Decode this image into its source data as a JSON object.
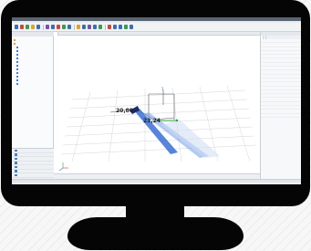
{
  "app": {
    "title": "",
    "menu": [
      "",
      "",
      "",
      "",
      "",
      ""
    ]
  },
  "toolbar": {
    "button_colors": [
      "#3a6fb5",
      "#d3443a",
      "#3a9b4b",
      "#e0a22b",
      "#3a6fb5",
      "#7a4fb3",
      "#3a6fb5",
      "#d3443a",
      "#3a9b4b",
      "#3a6fb5",
      "#e0a22b",
      "#3a6fb5",
      "#7a4fb3",
      "#3a6fb5",
      "#3a9b4b",
      "#d3443a",
      "#3a6fb5",
      "#3a6fb5",
      "#3a9b4b",
      "#3a6fb5"
    ]
  },
  "left_panel": {
    "header": "",
    "tree": [
      {
        "label": "",
        "icon": "folder-icon"
      },
      {
        "label": "",
        "icon": "folder-icon"
      },
      {
        "label": "",
        "icon": "node-icon"
      },
      {
        "label": "",
        "icon": "node-icon"
      },
      {
        "label": "",
        "icon": "node-icon"
      },
      {
        "label": "",
        "icon": "node-icon"
      },
      {
        "label": "",
        "icon": "node-icon"
      },
      {
        "label": "",
        "icon": "node-icon"
      },
      {
        "label": "",
        "icon": "node-icon"
      },
      {
        "label": "",
        "icon": "node-icon"
      },
      {
        "label": "",
        "icon": "node-icon"
      },
      {
        "label": "",
        "icon": "node-icon"
      },
      {
        "label": "",
        "icon": "node-icon"
      }
    ],
    "bottom_items": [
      {
        "label": "",
        "icon": "list-icon"
      },
      {
        "label": "",
        "icon": "list-icon"
      },
      {
        "label": "",
        "icon": "list-icon"
      },
      {
        "label": "",
        "icon": "list-icon"
      },
      {
        "label": "",
        "icon": "list-icon"
      },
      {
        "label": "",
        "icon": "list-icon"
      },
      {
        "label": "",
        "icon": "list-icon"
      }
    ]
  },
  "viewport": {
    "tab_label": "",
    "dimension_a": "20,80",
    "dimension_b": "23,24",
    "axis_label": "1",
    "status": [
      "",
      ""
    ]
  },
  "right_panel": {
    "title": "",
    "tabs": [
      "",
      ""
    ],
    "properties": [
      {
        "key": "",
        "value": ""
      },
      {
        "key": "",
        "value": ""
      },
      {
        "key": "",
        "value": ""
      },
      {
        "key": "",
        "value": ""
      },
      {
        "key": "",
        "value": ""
      },
      {
        "key": "",
        "value": ""
      },
      {
        "key": "",
        "value": ""
      },
      {
        "key": "",
        "value": ""
      },
      {
        "key": "",
        "value": ""
      },
      {
        "key": "",
        "value": ""
      },
      {
        "key": "",
        "value": ""
      },
      {
        "key": "",
        "value": ""
      },
      {
        "key": "",
        "value": ""
      },
      {
        "key": "",
        "value": ""
      },
      {
        "key": "",
        "value": ""
      },
      {
        "key": "",
        "value": ""
      },
      {
        "key": "",
        "value": ""
      },
      {
        "key": "",
        "value": ""
      },
      {
        "key": "",
        "value": ""
      },
      {
        "key": "",
        "value": ""
      }
    ]
  },
  "output": {
    "header": "",
    "text": ""
  }
}
